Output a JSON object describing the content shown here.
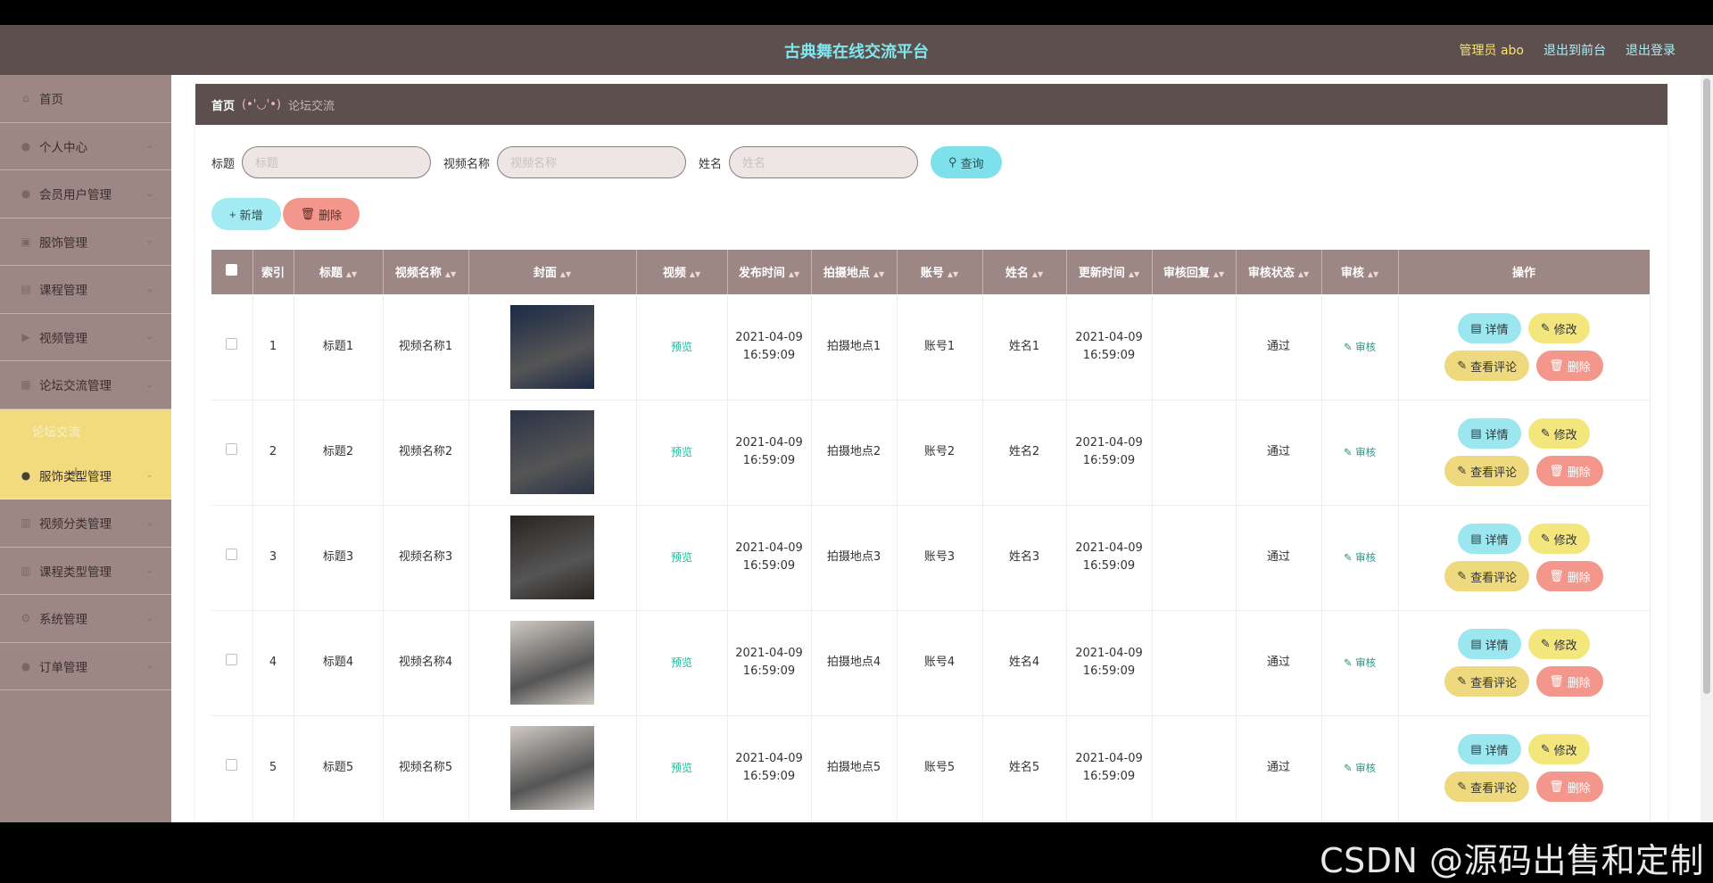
{
  "header": {
    "title": "古典舞在线交流平台",
    "admin": "管理员 abo",
    "to_front": "退出到前台",
    "logout": "退出登录"
  },
  "sidebar": {
    "items": [
      {
        "label": "首页",
        "icon": "home-icon"
      },
      {
        "label": "个人中心",
        "icon": "user-icon"
      },
      {
        "label": "会员用户管理",
        "icon": "user-icon"
      },
      {
        "label": "服饰管理",
        "icon": "shirt-icon"
      },
      {
        "label": "课程管理",
        "icon": "book-icon"
      },
      {
        "label": "视频管理",
        "icon": "video-icon"
      },
      {
        "label": "论坛交流管理",
        "icon": "forum-icon"
      },
      {
        "label": "论坛交流",
        "icon": ""
      },
      {
        "label": "服饰类型管理",
        "icon": "user-icon"
      },
      {
        "label": "视频分类管理",
        "icon": "folder-icon"
      },
      {
        "label": "课程类型管理",
        "icon": "folder-icon"
      },
      {
        "label": "系统管理",
        "icon": "gear-icon"
      },
      {
        "label": "订单管理",
        "icon": "user-icon"
      }
    ]
  },
  "breadcrumb": {
    "home": "首页",
    "separator": "(•'◡'•)",
    "current": "论坛交流"
  },
  "search": {
    "title_label": "标题",
    "title_placeholder": "标题",
    "video_label": "视频名称",
    "video_placeholder": "视频名称",
    "name_label": "姓名",
    "name_placeholder": "姓名",
    "query_button": "查询"
  },
  "actions": {
    "add": "新增",
    "delete": "删除"
  },
  "table": {
    "headers": [
      "索引",
      "标题",
      "视频名称",
      "封面",
      "视频",
      "发布时间",
      "拍摄地点",
      "账号",
      "姓名",
      "更新时间",
      "审核回复",
      "审核状态",
      "审核",
      "操作"
    ],
    "rows": [
      {
        "index": "1",
        "title": "标题1",
        "video_name": "视频名称1",
        "video": "预览",
        "pub_date": "2021-04-09",
        "pub_time": "16:59:09",
        "location": "拍摄地点1",
        "account": "账号1",
        "name": "姓名1",
        "upd_date": "2021-04-09",
        "upd_time": "16:59:09",
        "reply": "",
        "status": "通过",
        "audit": "审核",
        "cover_color": "#1b2a46"
      },
      {
        "index": "2",
        "title": "标题2",
        "video_name": "视频名称2",
        "video": "预览",
        "pub_date": "2021-04-09",
        "pub_time": "16:59:09",
        "location": "拍摄地点2",
        "account": "账号2",
        "name": "姓名2",
        "upd_date": "2021-04-09",
        "upd_time": "16:59:09",
        "reply": "",
        "status": "通过",
        "audit": "审核",
        "cover_color": "#2b3346"
      },
      {
        "index": "3",
        "title": "标题3",
        "video_name": "视频名称3",
        "video": "预览",
        "pub_date": "2021-04-09",
        "pub_time": "16:59:09",
        "location": "拍摄地点3",
        "account": "账号3",
        "name": "姓名3",
        "upd_date": "2021-04-09",
        "upd_time": "16:59:09",
        "reply": "",
        "status": "通过",
        "audit": "审核",
        "cover_color": "#2a2420"
      },
      {
        "index": "4",
        "title": "标题4",
        "video_name": "视频名称4",
        "video": "预览",
        "pub_date": "2021-04-09",
        "pub_time": "16:59:09",
        "location": "拍摄地点4",
        "account": "账号4",
        "name": "姓名4",
        "upd_date": "2021-04-09",
        "upd_time": "16:59:09",
        "reply": "",
        "status": "通过",
        "audit": "审核",
        "cover_color": "#cfc9c2"
      },
      {
        "index": "5",
        "title": "标题5",
        "video_name": "视频名称5",
        "video": "预览",
        "pub_date": "2021-04-09",
        "pub_time": "16:59:09",
        "location": "拍摄地点5",
        "account": "账号5",
        "name": "姓名5",
        "upd_date": "2021-04-09",
        "upd_time": "16:59:09",
        "reply": "",
        "status": "通过",
        "audit": "审核",
        "cover_color": "#cfc9c2"
      }
    ],
    "op_detail": "详情",
    "op_edit": "修改",
    "op_comment": "查看评论",
    "op_delete": "删除"
  },
  "watermark": "CSDN @源码出售和定制"
}
